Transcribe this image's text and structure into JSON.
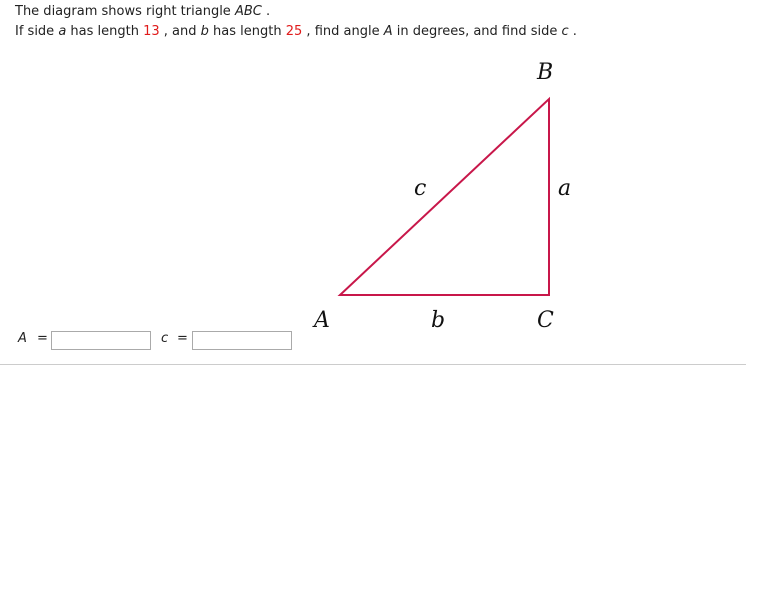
{
  "problem": {
    "line1": {
      "t1": "The diagram shows right triangle ",
      "v1": "ABC",
      "t2": " ."
    },
    "line2": {
      "t1": "If side ",
      "v1": "a",
      "t2": " has length ",
      "n1": "13",
      "t3": " , and ",
      "v2": "b",
      "t4": " has length ",
      "n2": "25",
      "t5": " , find angle ",
      "v3": "A",
      "t6": " in degrees, and find side ",
      "v4": "c",
      "t7": " ."
    }
  },
  "diagram": {
    "vertex_labels": {
      "A": "A",
      "B": "B",
      "C": "C"
    },
    "side_labels": {
      "a": "a",
      "b": "b",
      "c": "c"
    },
    "stroke_color": "#c8174a",
    "side_a": 13,
    "side_b": 25
  },
  "answers": {
    "angle_label": "A",
    "side_label": "c",
    "equals": "=",
    "angle_value": "",
    "side_value": ""
  }
}
